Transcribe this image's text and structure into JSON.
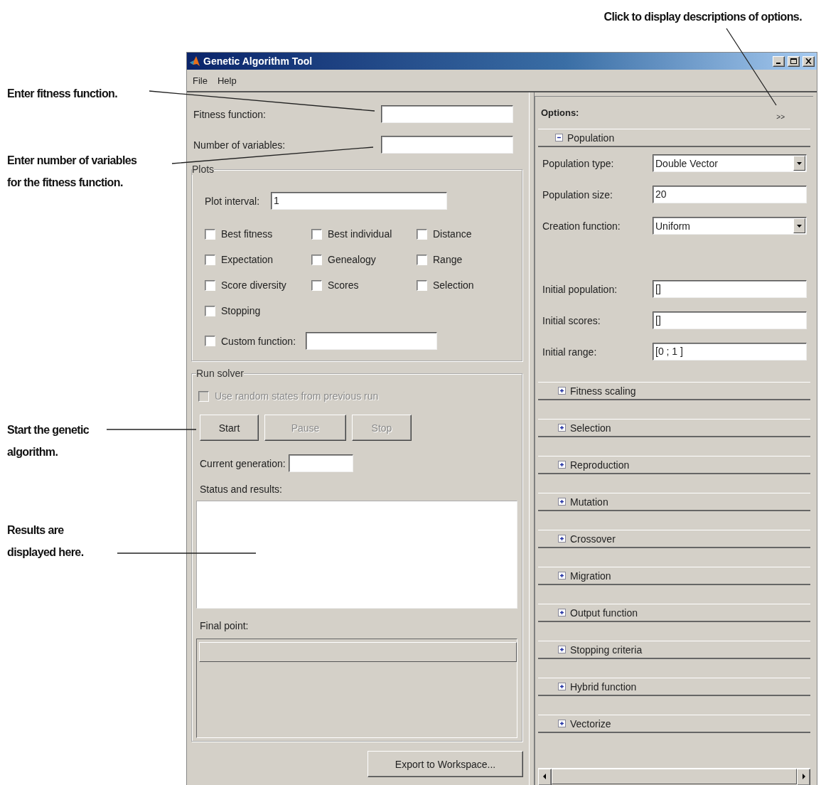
{
  "callouts": [
    {
      "text": "Click to display descriptions of options."
    },
    {
      "text": "Enter fitness function."
    },
    {
      "text": "Enter number of variables\nfor the fitness function."
    },
    {
      "text": "Start the genetic\nalgorithm."
    },
    {
      "text": "Results are\ndisplayed here."
    }
  ],
  "window": {
    "title": "Genetic Algorithm Tool",
    "menu": [
      "File",
      "Help"
    ]
  },
  "problem": {
    "fields": [
      {
        "label": "Fitness function:"
      },
      {
        "label": "Number of variables:"
      }
    ]
  },
  "plots": {
    "title": "Plots",
    "plot_interval": {
      "label": "Plot interval:",
      "value": "1"
    },
    "checkboxes": [
      {
        "label": "Best fitness",
        "checked": false
      },
      {
        "label": "Best individual",
        "checked": false
      },
      {
        "label": "Distance",
        "checked": false
      },
      {
        "label": "Expectation",
        "checked": false
      },
      {
        "label": "Genealogy",
        "checked": false
      },
      {
        "label": "Range",
        "checked": false
      },
      {
        "label": "Score diversity",
        "checked": false
      },
      {
        "label": "Scores",
        "checked": false
      },
      {
        "label": "Selection",
        "checked": false
      },
      {
        "label": "Stopping",
        "checked": false
      }
    ],
    "custom_function": {
      "label": "Custom function:",
      "checked": false
    }
  },
  "run_solver": {
    "title": "Run solver",
    "random_states": {
      "label": "Use random states from previous run",
      "checked": false,
      "disabled": true
    },
    "buttons": [
      {
        "label": "Start",
        "disabled": false
      },
      {
        "label": "Pause",
        "disabled": true
      },
      {
        "label": "Stop",
        "disabled": true
      }
    ],
    "current_generation": {
      "label": "Current generation:"
    },
    "status": {
      "label": "Status and results:"
    },
    "final_point": {
      "label": "Final point:"
    }
  },
  "export_button": {
    "label": "Export to Workspace..."
  },
  "options": {
    "title": "Options:",
    "more_button": ">>",
    "sections": [
      {
        "title": "Population",
        "expanded": true,
        "field_groups": [
          [
            {
              "kind": "dropdown",
              "label": "Population type:",
              "value": "Double Vector"
            },
            {
              "kind": "text",
              "label": "Population size:",
              "value": "20"
            },
            {
              "kind": "dropdown",
              "label": "Creation function:",
              "value": "Uniform"
            }
          ],
          [
            {
              "kind": "text",
              "label": "Initial population:",
              "value": "[]"
            },
            {
              "kind": "text",
              "label": "Initial scores:",
              "value": "[]"
            },
            {
              "kind": "text",
              "label": "Initial range:",
              "value": "[0 ; 1 ]"
            }
          ]
        ]
      },
      {
        "title": "Fitness scaling",
        "expanded": false
      },
      {
        "title": "Selection",
        "expanded": false
      },
      {
        "title": "Reproduction",
        "expanded": false
      },
      {
        "title": "Mutation",
        "expanded": false
      },
      {
        "title": "Crossover",
        "expanded": false
      },
      {
        "title": "Migration",
        "expanded": false
      },
      {
        "title": "Output function",
        "expanded": false
      },
      {
        "title": "Stopping criteria",
        "expanded": false
      },
      {
        "title": "Hybrid function",
        "expanded": false
      },
      {
        "title": "Vectorize",
        "expanded": false
      }
    ]
  }
}
